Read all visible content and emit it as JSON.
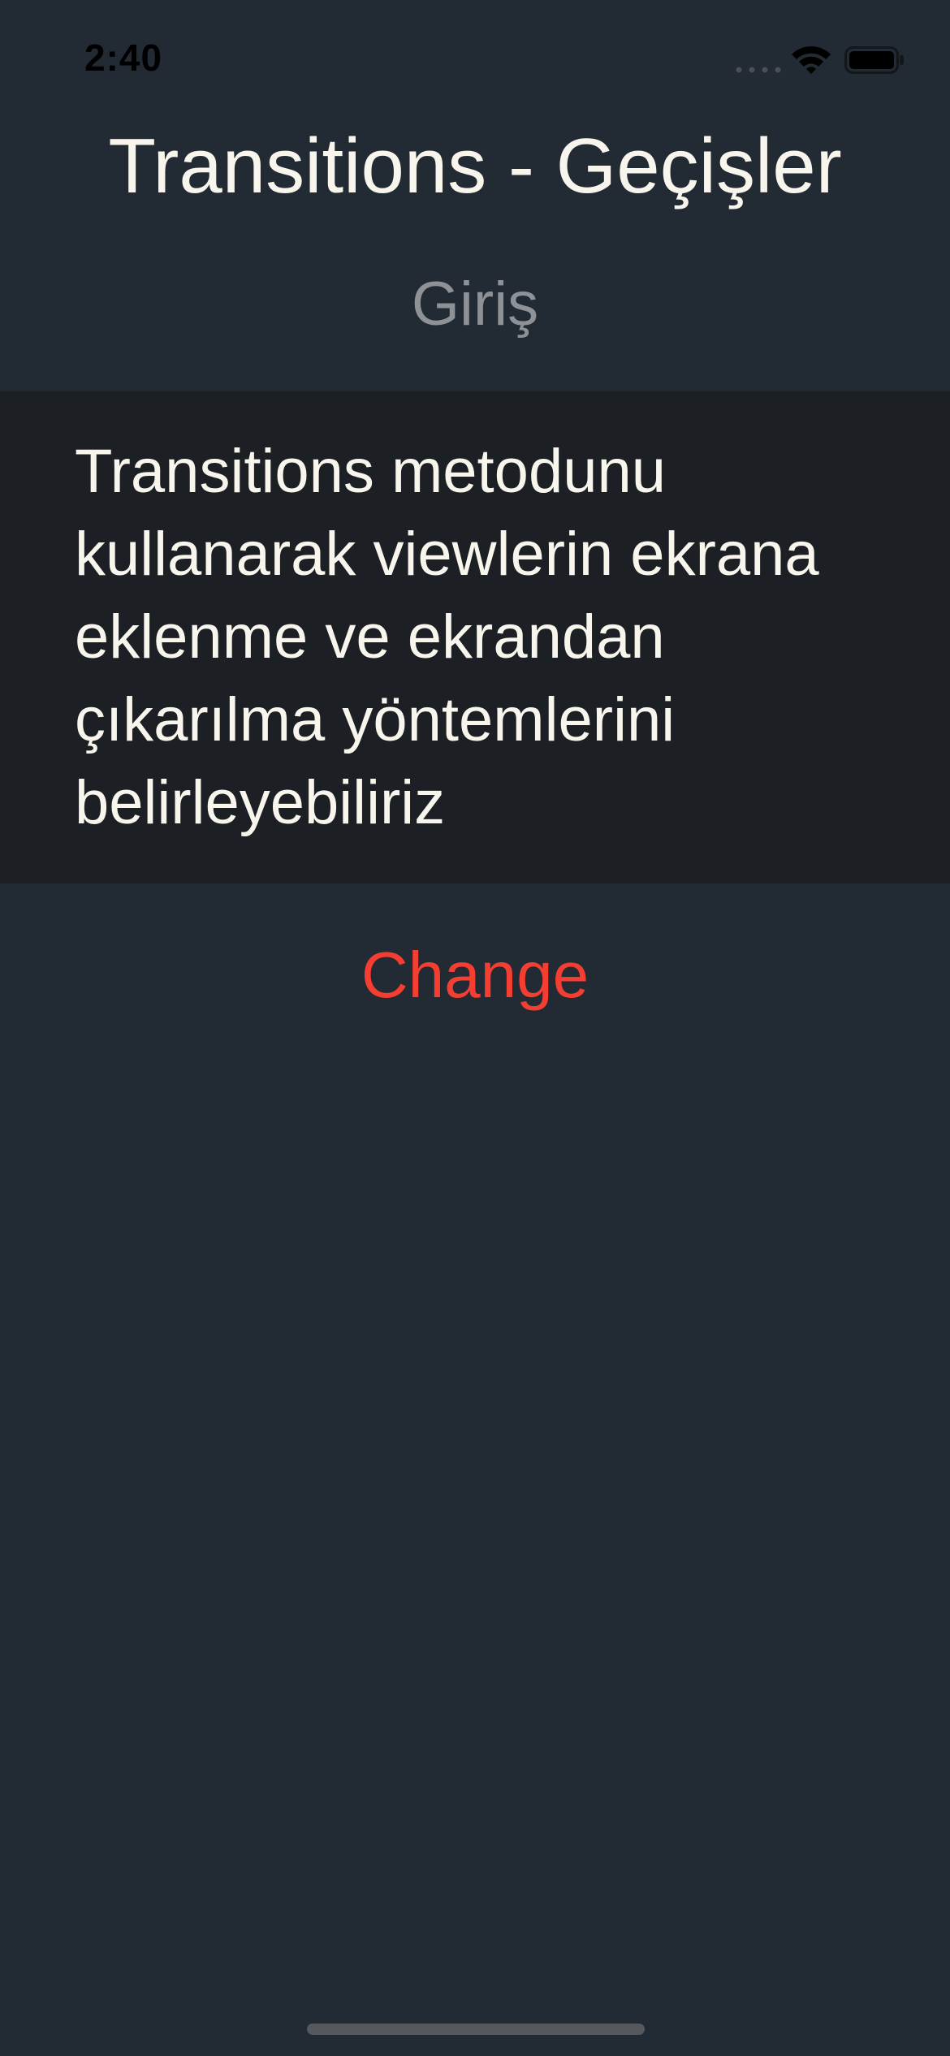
{
  "status_bar": {
    "time": "2:40",
    "icons": [
      "signal-dots-icon",
      "wifi-icon",
      "battery-icon"
    ]
  },
  "header": {
    "title": "Transitions - Geçişler",
    "subtitle": "Giriş"
  },
  "description": {
    "line1": "Transitions metodunu",
    "line2": "kullanarak viewlerin ekrana",
    "line3": "eklenme ve ekrandan",
    "line4": "çıkarılma yöntemlerini",
    "line5": "belirleyebiliriz"
  },
  "actions": {
    "change_label": "Change"
  },
  "colors": {
    "background": "#222a33",
    "panel": "#1c2025",
    "text": "#f7f5ec",
    "subtitle": "#8e9196",
    "accent": "#f53e32"
  }
}
